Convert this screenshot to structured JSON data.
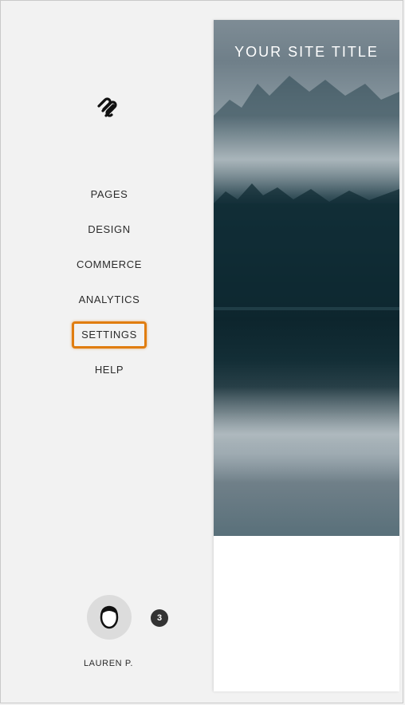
{
  "nav": {
    "items": [
      {
        "label": "PAGES"
      },
      {
        "label": "DESIGN"
      },
      {
        "label": "COMMERCE"
      },
      {
        "label": "ANALYTICS"
      },
      {
        "label": "SETTINGS",
        "highlighted": true
      },
      {
        "label": "HELP"
      }
    ]
  },
  "account": {
    "name": "LAUREN P.",
    "notification_count": "3"
  },
  "preview": {
    "site_title": "YOUR SITE TITLE"
  },
  "colors": {
    "highlight": "#e07d10",
    "sidebar_bg": "#f2f2f2",
    "badge_bg": "#333333"
  },
  "icons": [
    "squarespace-logo-icon",
    "avatar-icon"
  ]
}
